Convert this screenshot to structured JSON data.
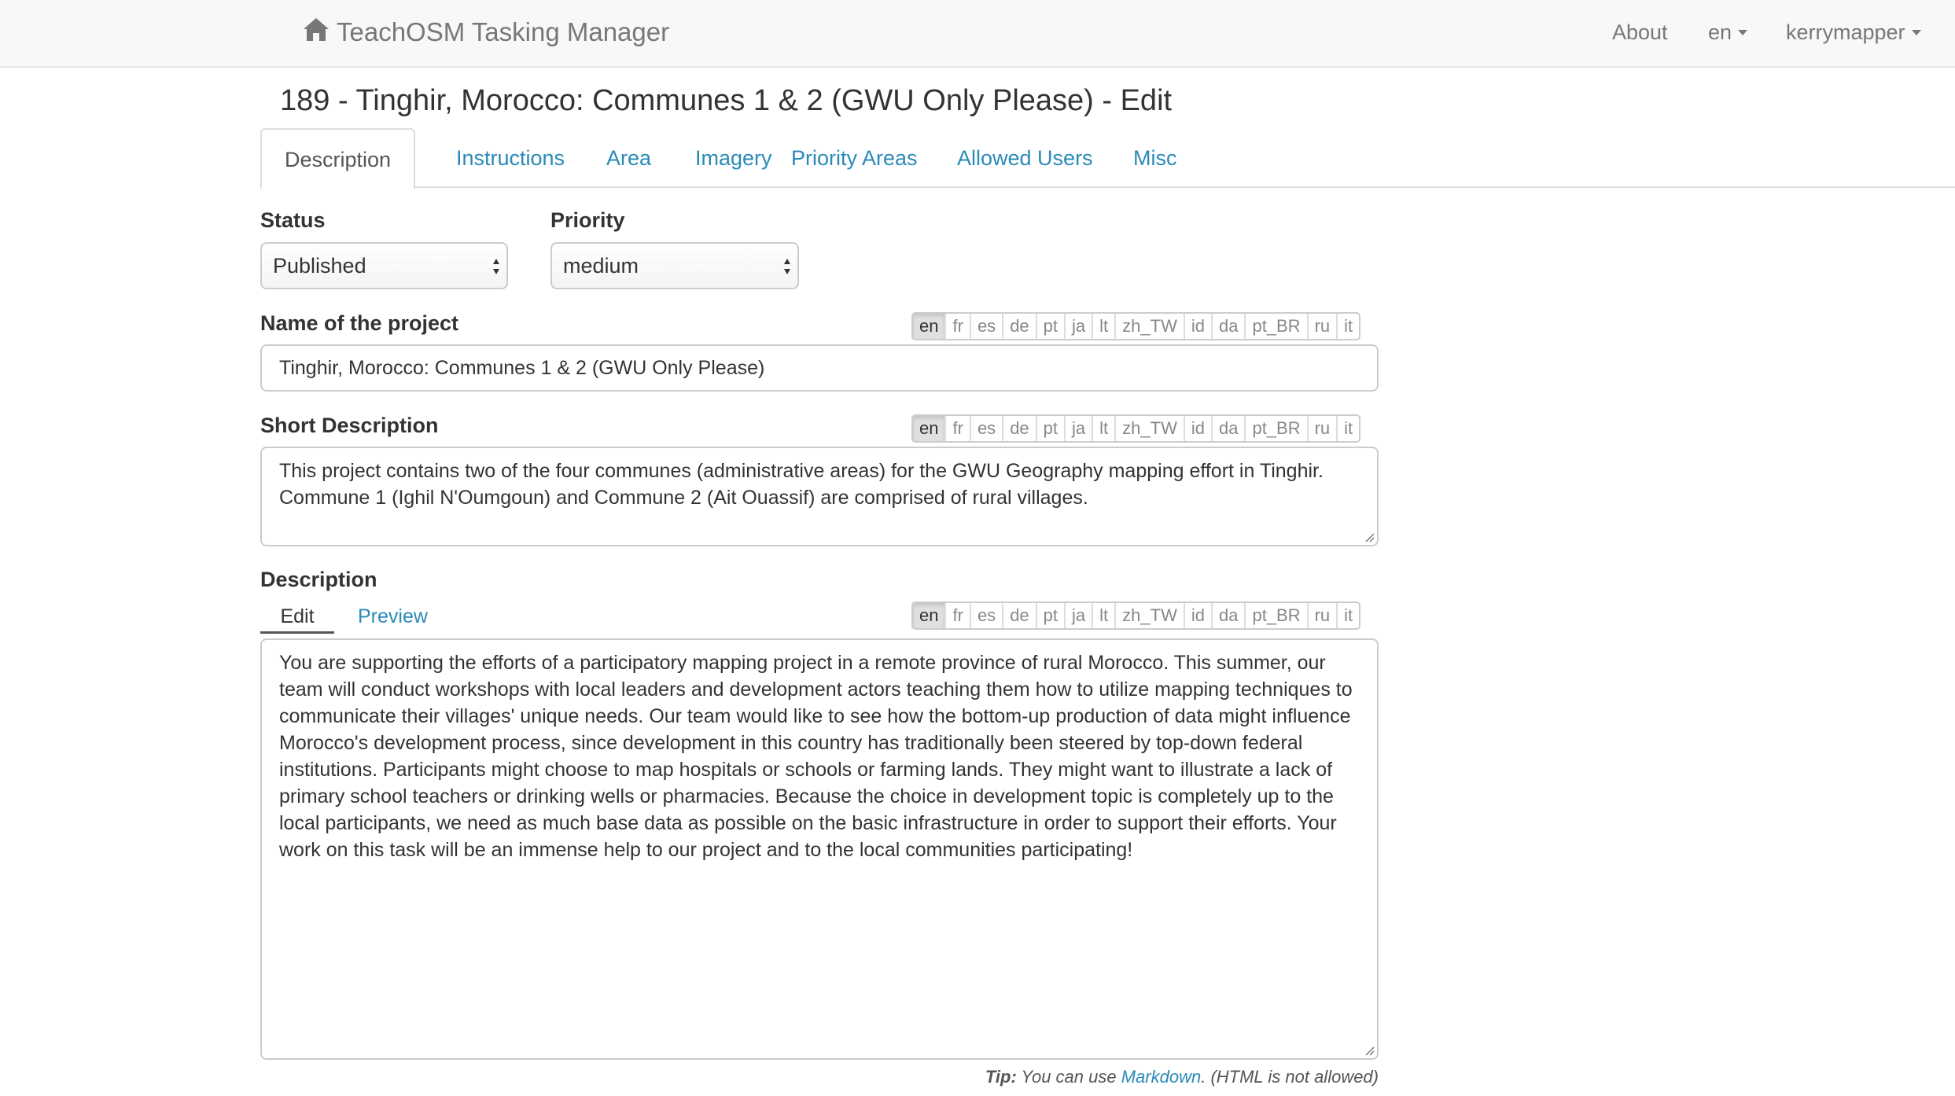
{
  "navbar": {
    "brand": "TeachOSM Tasking Manager",
    "about": "About",
    "language": "en",
    "user": "kerrymapper"
  },
  "page": {
    "title": "189 - Tinghir, Morocco: Communes 1 & 2 (GWU Only Please) - Edit"
  },
  "tabs": [
    {
      "label": "Description",
      "active": true
    },
    {
      "label": "Instructions"
    },
    {
      "label": "Area"
    },
    {
      "label": "Imagery"
    },
    {
      "label": "Priority Areas"
    },
    {
      "label": "Allowed Users"
    },
    {
      "label": "Misc"
    }
  ],
  "form": {
    "status": {
      "label": "Status",
      "value": "Published"
    },
    "priority": {
      "label": "Priority",
      "value": "medium"
    },
    "name": {
      "label": "Name of the project",
      "value": "Tinghir, Morocco: Communes 1 & 2 (GWU Only Please)"
    },
    "short_description": {
      "label": "Short Description",
      "value": "This project contains two of the four communes (administrative areas) for the GWU Geography mapping effort in Tinghir. Commune 1 (Ighil N'Oumgoun) and Commune 2 (Ait Ouassif) are comprised of rural villages."
    },
    "description": {
      "label": "Description",
      "edit_tab": "Edit",
      "preview_tab": "Preview",
      "value": "You are supporting the efforts of a participatory mapping project in a remote province of rural Morocco. This summer, our team will conduct workshops with local leaders and development actors teaching them how to utilize mapping techniques to communicate their villages' unique needs. Our team would like to see how the bottom-up production of data might influence Morocco's development process, since development in this country has traditionally been steered by top-down federal institutions. Participants might choose to map hospitals or schools or farming lands. They might want to illustrate a lack of primary school teachers or drinking wells or pharmacies. Because the choice in development topic is completely up to the local participants, we need as much base data as possible on the basic infrastructure in order to support their efforts. Your work on this task will be an immense help to our project and to the local communities participating!"
    },
    "languages": [
      "en",
      "fr",
      "es",
      "de",
      "pt",
      "ja",
      "lt",
      "zh_TW",
      "id",
      "da",
      "pt_BR",
      "ru",
      "it"
    ],
    "active_language": "en"
  },
  "tip": {
    "head": "Tip:",
    "text_before": " You can use ",
    "link": "Markdown",
    "text_after": ". (HTML is not allowed)"
  },
  "colors": {
    "link": "#2a8ab8",
    "navbar_bg": "#f8f8f8",
    "border": "#cccccc"
  },
  "icons": {
    "brand": "home-icon",
    "select": "updown-arrows-icon",
    "resize": "resize-handle-icon"
  }
}
